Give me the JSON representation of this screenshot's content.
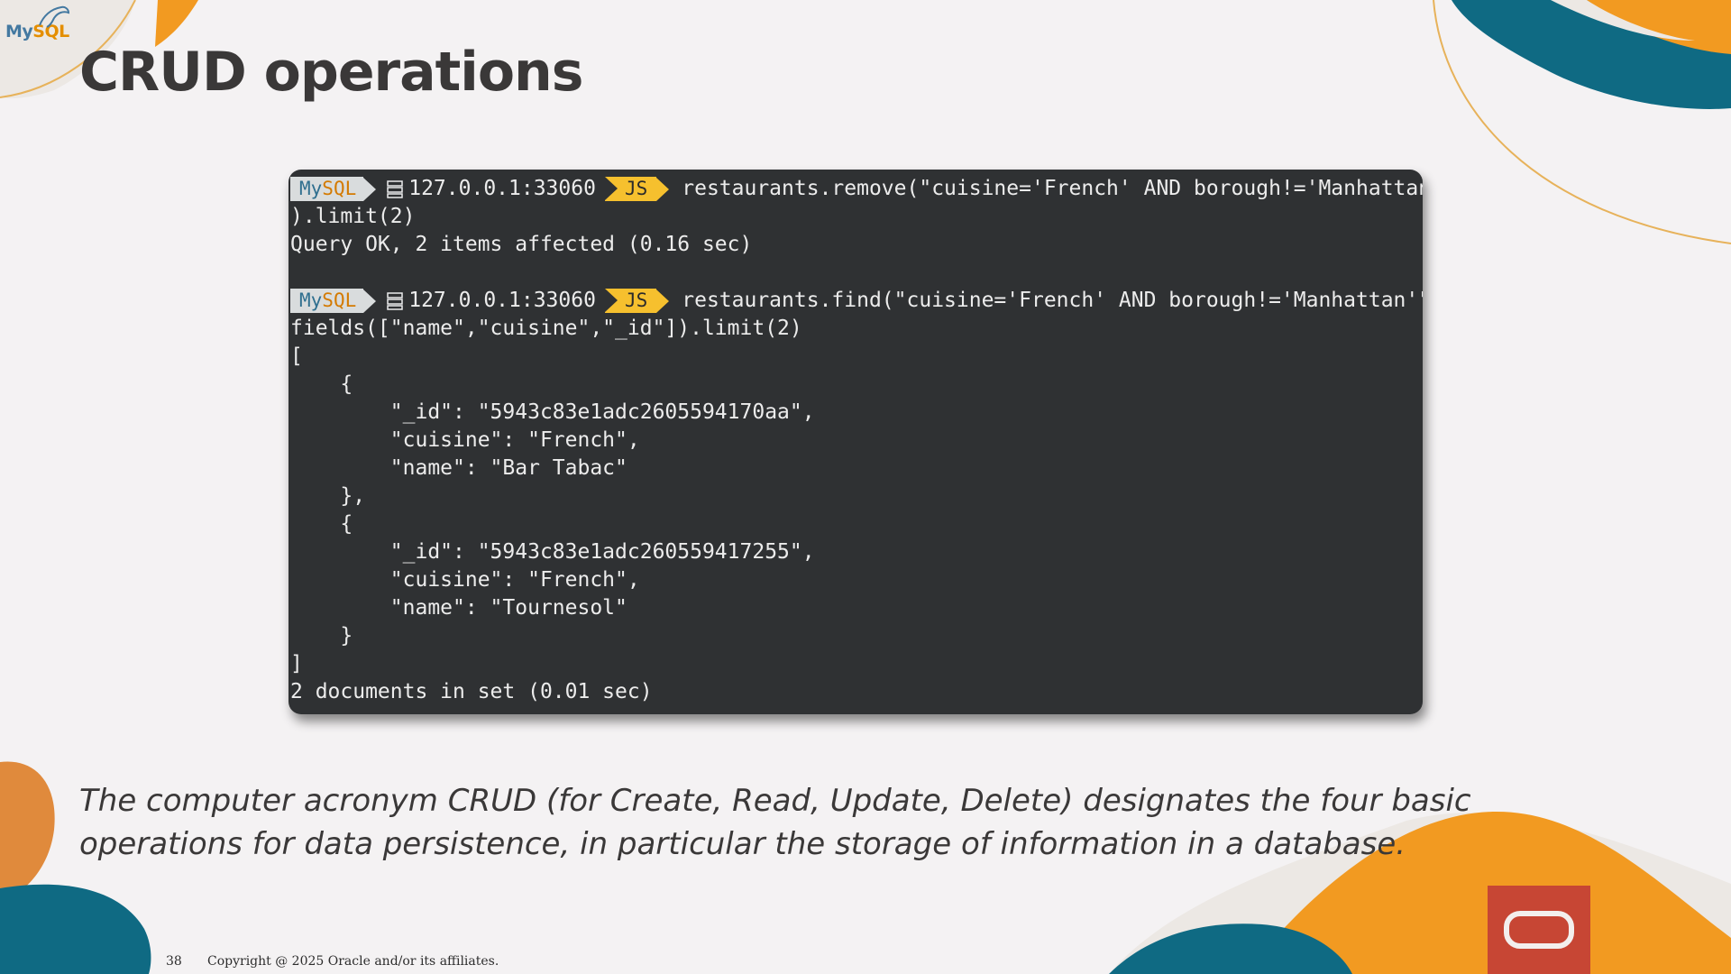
{
  "logo": {
    "text_my": "My",
    "text_sql": "SQL"
  },
  "slide": {
    "title": "CRUD operations",
    "caption": "The computer acronym CRUD (for Create, Read, Update, Delete) designates the four basic operations for data persistence, in particular the storage of information in a database.",
    "page_number": "38",
    "copyright": "Copyright @ 2025 Oracle and/or its affiliates."
  },
  "terminal": {
    "prompt": {
      "mysql_my": "My",
      "mysql_sql": "SQL",
      "host": "127.0.0.1:33060",
      "mode": "JS"
    },
    "command1": "restaurants.remove(\"cuisine='French' AND borough!='Manhattan'\"",
    "lines": [
      ").limit(2)",
      "Query OK, 2 items affected (0.16 sec)",
      ""
    ],
    "command2": "restaurants.find(\"cuisine='French' AND borough!='Manhattan'\").",
    "output": [
      "fields([\"name\",\"cuisine\",\"_id\"]).limit(2)",
      "[",
      "    {",
      "        \"_id\": \"5943c83e1adc2605594170aa\",",
      "        \"cuisine\": \"French\",",
      "        \"name\": \"Bar Tabac\"",
      "    },",
      "    {",
      "        \"_id\": \"5943c83e1adc260559417255\",",
      "        \"cuisine\": \"French\",",
      "        \"name\": \"Tournesol\"",
      "    }",
      "]",
      "2 documents in set (0.01 sec)"
    ]
  },
  "colors": {
    "background": "#f4f2f3",
    "terminal_bg": "#2f3133",
    "orange": "#f29a21",
    "teal": "#0f6a83",
    "oracle_red": "#c74634",
    "js_yellow": "#f6c02e"
  },
  "icons": [
    "dolphin-icon",
    "server-icon",
    "oracle-logo-icon"
  ]
}
